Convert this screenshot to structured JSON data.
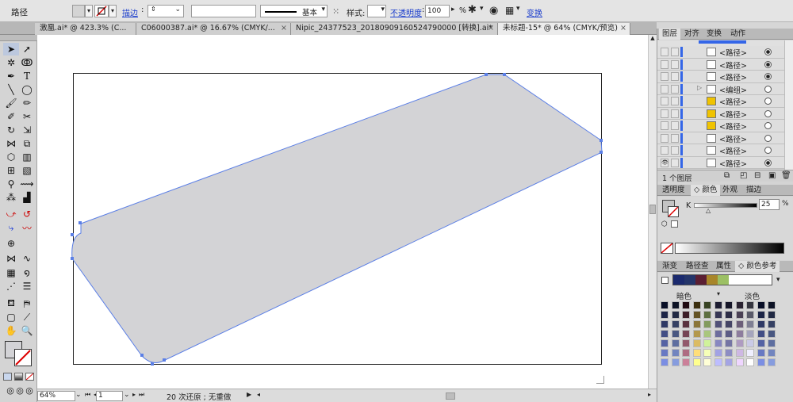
{
  "control_bar": {
    "selection_label": "路径",
    "stroke_link": "描边",
    "stroke_style_label": "基本",
    "style_label": "样式:",
    "opacity_link": "不透明度",
    "opacity_value": "100",
    "opacity_unit": "%",
    "transform_link": "变换"
  },
  "tabs": [
    {
      "label": "激凰.ai* @ 423.3% (C...",
      "close": "×"
    },
    {
      "label": "C06000387.ai* @ 16.67% (CMYK/...",
      "close": "×"
    },
    {
      "label": "Nipic_24377523_20180909160524790000 [转换].ai*",
      "close": "×"
    },
    {
      "label": "未标题-15* @ 64% (CMYK/预览)",
      "close": "×"
    }
  ],
  "status_bar": {
    "zoom": "64%",
    "page": "1",
    "history": "20 次还原 ; 无重做"
  },
  "layers_panel": {
    "tabs": [
      "图层",
      "对齐",
      "变换",
      "动作"
    ],
    "rows": [
      {
        "name": "<路径>",
        "thumb": "white",
        "target": "filled"
      },
      {
        "name": "<路径>",
        "thumb": "white",
        "target": "filled"
      },
      {
        "name": "<路径>",
        "thumb": "white",
        "target": "filled"
      },
      {
        "name": "<编组>",
        "thumb": "white",
        "target": "empty"
      },
      {
        "name": "<路径>",
        "thumb": "yellow",
        "target": "empty"
      },
      {
        "name": "<路径>",
        "thumb": "yellow",
        "target": "empty"
      },
      {
        "name": "<路径>",
        "thumb": "yellow",
        "target": "empty"
      },
      {
        "name": "<路径>",
        "thumb": "white",
        "target": "empty"
      },
      {
        "name": "<路径>",
        "thumb": "white",
        "target": "empty"
      },
      {
        "name": "<路径>",
        "thumb": "white",
        "target": "filled"
      }
    ],
    "footer": "1 个图层"
  },
  "color_panel": {
    "tabs": [
      "透明度",
      "颜色",
      "外观",
      "描边"
    ],
    "channel": "K",
    "value": "25",
    "unit": "%"
  },
  "guide_panel": {
    "tabs": [
      "渐变",
      "路径查",
      "属性",
      "颜色参考"
    ],
    "dark_label": "暗色",
    "light_label": "淡色",
    "harmony": [
      "#1b2a6e",
      "#24356a",
      "#5b1f33",
      "#a8862a",
      "#9cc064"
    ]
  },
  "colors": {
    "shape_fill": "#d3d3d6",
    "path_stroke": "#5b7fe6",
    "ui_bg": "#d4d4d4"
  }
}
